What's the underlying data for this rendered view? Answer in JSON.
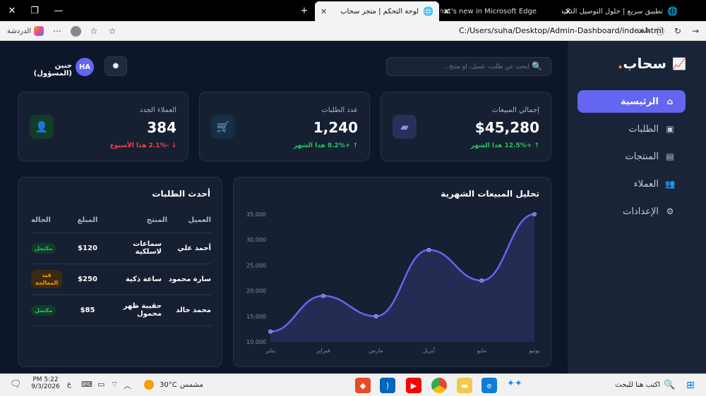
{
  "browser": {
    "tabs": [
      {
        "title": "تطبيق سريع | حلول التوصيل الذكية",
        "active": false
      },
      {
        "title": "What's new in Microsoft Edge",
        "active": false
      },
      {
        "title": "لوحة التحكم | متجر سحاب",
        "active": true
      }
    ],
    "new_tab": "+",
    "url": "C:/Users/suha/Desktop/Admin-Dashboard/index.html",
    "file_label": "ملف",
    "copilot_label": "الدردشة"
  },
  "sidebar": {
    "brand": "سحاب",
    "brand_dot": ".",
    "items": [
      {
        "label": "الرئيسية",
        "icon": "home-icon",
        "glyph": "⌂",
        "active": true
      },
      {
        "label": "الطلبات",
        "icon": "bag-icon",
        "glyph": "▣",
        "active": false
      },
      {
        "label": "المنتجات",
        "icon": "box-icon",
        "glyph": "▤",
        "active": false
      },
      {
        "label": "العملاء",
        "icon": "users-icon",
        "glyph": "👥",
        "active": false
      },
      {
        "label": "الإعدادات",
        "icon": "gear-icon",
        "glyph": "⚙",
        "active": false
      }
    ]
  },
  "header": {
    "search_placeholder": "ابحث عن طلب، عميل، أو منتج...",
    "user_name": "حنين (المسؤول)",
    "avatar_initials": "HA",
    "theme_icon": "sun-icon"
  },
  "stats": [
    {
      "label": "إجمالي المبيعات",
      "value": "$45,280",
      "trend": "↑ +12.5% هذا الشهر",
      "trend_color": "#22c55e",
      "icon": "wallet-icon",
      "icon_bg": "#2a2f5a",
      "icon_color": "#8b8ff8"
    },
    {
      "label": "عدد الطلبات",
      "value": "1,240",
      "trend": "↑ +8.2% هذا الشهر",
      "trend_color": "#22c55e",
      "icon": "cart-icon",
      "icon_bg": "#143048",
      "icon_color": "#38bdf8"
    },
    {
      "label": "العملاء الجدد",
      "value": "384",
      "trend": "↓ -2.1% هذا الأسبوع",
      "trend_color": "#ef4444",
      "icon": "user-plus-icon",
      "icon_bg": "#123b2a",
      "icon_color": "#22c55e"
    }
  ],
  "chart_data": {
    "type": "line",
    "title": "تحليل المبيعات الشهرية",
    "categories": [
      "يناير",
      "فبراير",
      "مارس",
      "أبريل",
      "مايو",
      "يونيو"
    ],
    "series": [
      {
        "name": "",
        "values": [
          12000,
          19000,
          15000,
          28000,
          22000,
          35000
        ]
      }
    ],
    "ylim": [
      10000,
      35000
    ],
    "yticks": [
      "10,000",
      "15,000",
      "20,000",
      "25,000",
      "30,000",
      "35,000"
    ],
    "color": "#6366f1",
    "grid": false
  },
  "orders": {
    "title": "أحدث الطلبات",
    "columns": [
      "العميل",
      "المنتج",
      "المبلغ",
      "الحالة"
    ],
    "rows": [
      {
        "customer": "أحمد علي",
        "product": "سماعات لاسلكية",
        "amount": "$120",
        "status": "مكتمل",
        "status_type": "done"
      },
      {
        "customer": "سارة محمود",
        "product": "ساعة ذكية",
        "amount": "$250",
        "status": "قيد المعالجة",
        "status_type": "proc"
      },
      {
        "customer": "محمد خالد",
        "product": "حقيبة ظهر محمول",
        "amount": "$85",
        "status": "مكتمل",
        "status_type": "done"
      }
    ]
  },
  "taskbar": {
    "search": "اكتب هنا للبحث",
    "weather_temp": "30°C",
    "weather_text": "مشمس",
    "time": "PM 5:22",
    "date": "9/3/2026",
    "lang": "ع"
  }
}
